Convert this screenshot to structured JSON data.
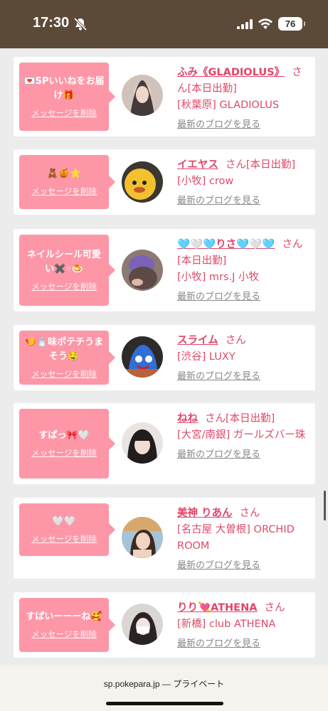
{
  "status": {
    "time": "17:30",
    "battery": "76"
  },
  "cards": [
    {
      "message": "💌SPいいねをお届け🎁",
      "delete": "メッセージを削除",
      "name": "ふみ《GLADIOLUS》",
      "san": "さん",
      "line1": "[本日出勤]",
      "line2": "[秋葉原] GLADIOLUS",
      "blog": "最新のブログを見る"
    },
    {
      "message": "🧸🍯⭐",
      "delete": "メッセージを削除",
      "name": "イエヤス",
      "san": "さん",
      "line1": "[本日出勤]",
      "line2": "[小牧] crow",
      "blog": "最新のブログを見る"
    },
    {
      "message": "ネイルシール可愛い✖️◦🍮",
      "delete": "メッセージを削除",
      "name": "🩵🤍🩵りさ🩵🤍🩵",
      "san": "さん",
      "line1": "[本日出勤]",
      "line2": "[小牧] mrs.J 小牧",
      "blog": "最新のブログを見る"
    },
    {
      "message": "🍤🧂味ポテチうまそう🤤",
      "delete": "メッセージを削除",
      "name": "スライム",
      "san": "さん",
      "line1": "",
      "line2": "[渋谷] LUXY",
      "blog": "最新のブログを見る"
    },
    {
      "message": "すぱっ🎀🤍",
      "delete": "メッセージを削除",
      "name": "ねね",
      "san": "さん",
      "line1": "[本日出勤]",
      "line2": "[大宮/南銀] ガールズバー珠",
      "blog": "最新のブログを見る"
    },
    {
      "message": "🤍🤍",
      "delete": "メッセージを削除",
      "name": "美神 りあん",
      "san": "さん",
      "line1": "",
      "line2": "[名古屋 大曽根] ORCHID ROOM",
      "blog": "最新のブログを見る"
    },
    {
      "message": "すぱいーーーね🥰",
      "delete": "メッセージを削除",
      "name": "りり💘ATHENA",
      "san": "さん",
      "line1": "",
      "line2": "[新橋] club ATHENA",
      "blog": "最新のブログを見る"
    }
  ],
  "footer": {
    "domain": "sp.pokepara.jp",
    "suffix": "— プライベート"
  },
  "colors": {
    "accent": "#e2456a",
    "bubble": "#fd97a7",
    "statusbar": "#5c4a39"
  }
}
